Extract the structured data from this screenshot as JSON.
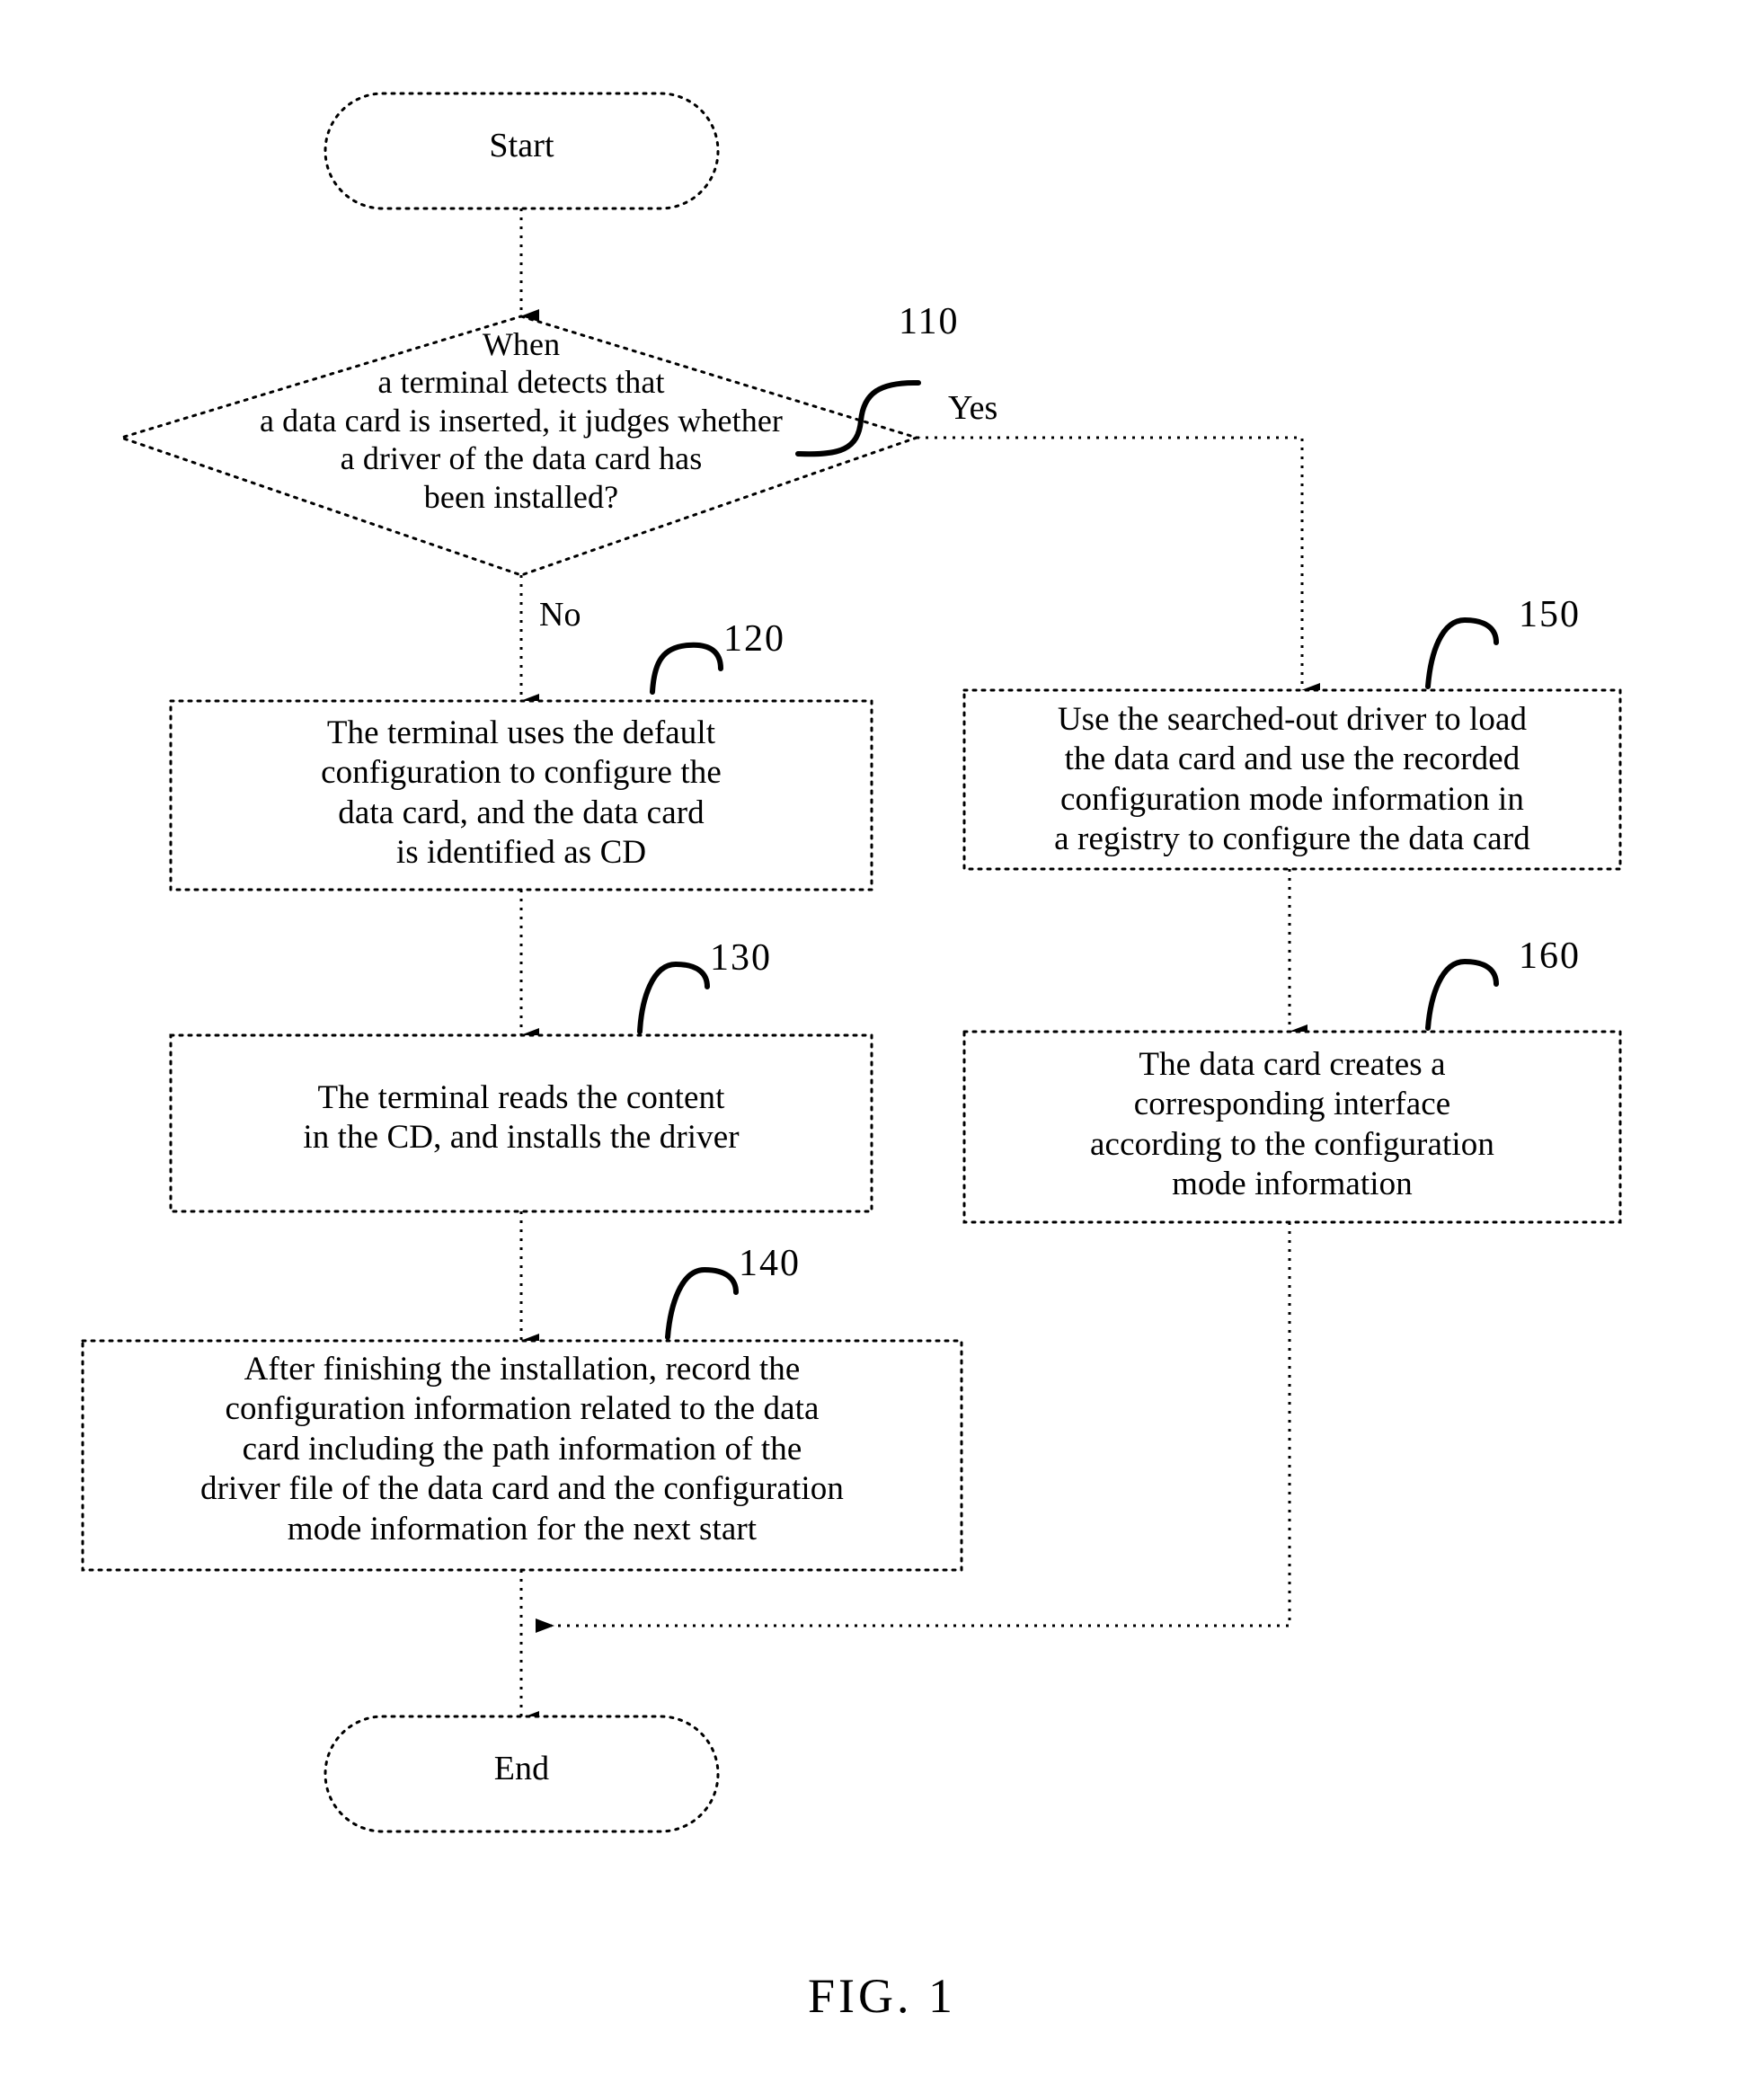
{
  "figure": {
    "caption": "FIG. 1"
  },
  "nodes": {
    "start": {
      "id": "start",
      "shape": "terminator",
      "label": "Start"
    },
    "decision_110": {
      "id": "110",
      "shape": "decision",
      "ref": "110",
      "label": "When\na terminal detects that\na data card is inserted, it judges whether\na driver of the data card has\nbeen installed?"
    },
    "process_120": {
      "id": "120",
      "shape": "process",
      "ref": "120",
      "label": "The terminal uses the default\nconfiguration to configure the\ndata card, and the data card\nis identified as CD"
    },
    "process_130": {
      "id": "130",
      "shape": "process",
      "ref": "130",
      "label": "The terminal reads the content\nin the CD, and installs the driver"
    },
    "process_140": {
      "id": "140",
      "shape": "process",
      "ref": "140",
      "label": "After finishing the installation, record the\nconfiguration information related to the data\ncard including the path information of the\ndriver file of the data card and the configuration\nmode information for the next start"
    },
    "process_150": {
      "id": "150",
      "shape": "process",
      "ref": "150",
      "label": "Use the searched-out driver to load\nthe data card and use the recorded\nconfiguration mode information in\na registry to configure the data card"
    },
    "process_160": {
      "id": "160",
      "shape": "process",
      "ref": "160",
      "label": "The data card creates a\ncorresponding interface\naccording to the configuration\nmode information"
    },
    "end": {
      "id": "end",
      "shape": "terminator",
      "label": "End"
    }
  },
  "branch_labels": {
    "yes": "Yes",
    "no": "No"
  },
  "reference_numbers": {
    "r110": "110",
    "r120": "120",
    "r130": "130",
    "r140": "140",
    "r150": "150",
    "r160": "160"
  },
  "style": {
    "stroke": "#000000",
    "background": "#ffffff"
  }
}
